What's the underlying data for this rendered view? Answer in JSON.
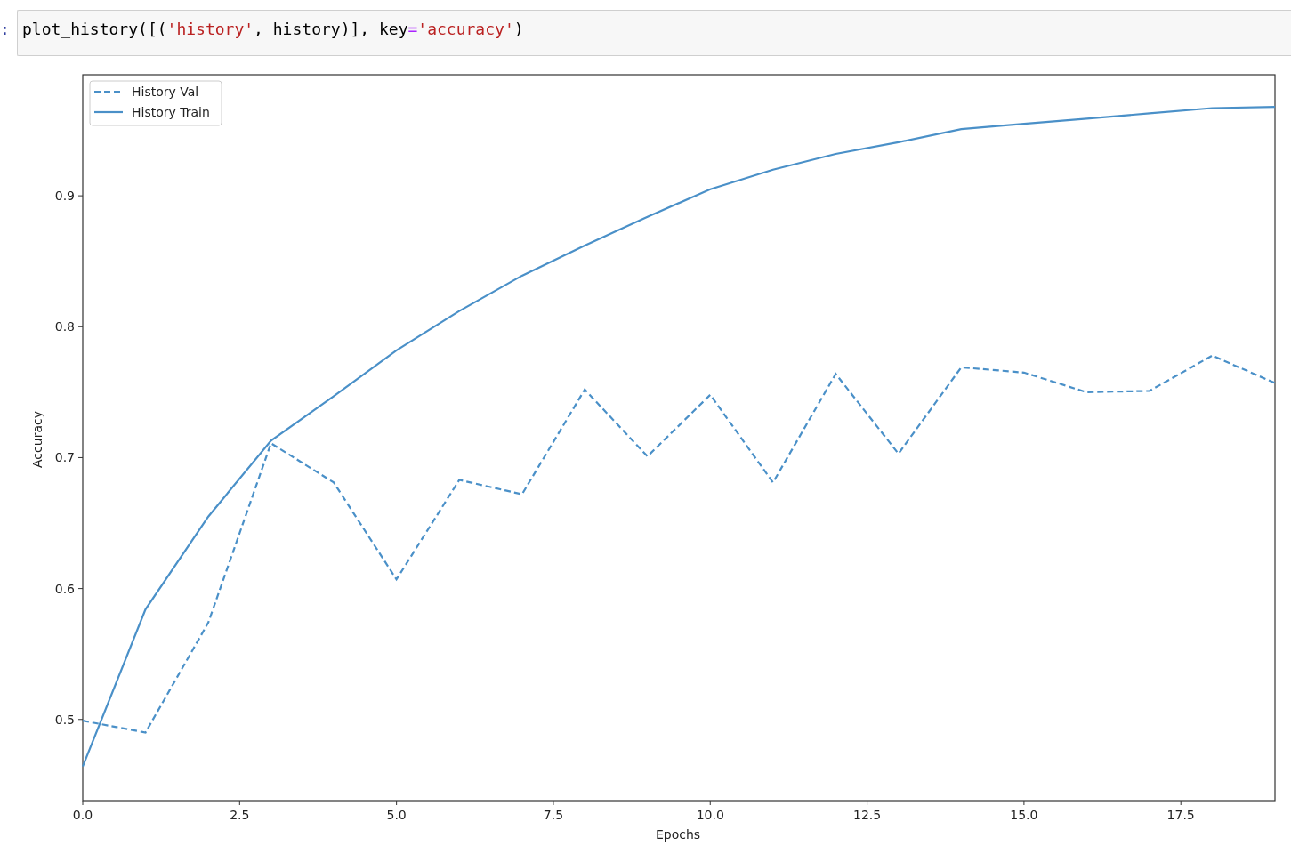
{
  "code_cell": {
    "prompt": ":",
    "tokens": [
      {
        "text": "plot_history([(",
        "kind": "plain"
      },
      {
        "text": "'history'",
        "kind": "string"
      },
      {
        "text": ", history)], key",
        "kind": "plain"
      },
      {
        "text": "=",
        "kind": "operator"
      },
      {
        "text": "'accuracy'",
        "kind": "string"
      },
      {
        "text": ")",
        "kind": "plain"
      }
    ]
  },
  "output": {
    "chart_data": {
      "type": "line",
      "xlabel": "Epochs",
      "ylabel": "Accuracy",
      "x": [
        0,
        1,
        2,
        3,
        4,
        5,
        6,
        7,
        8,
        9,
        10,
        11,
        12,
        13,
        14,
        15,
        16,
        17,
        18,
        19
      ],
      "series": [
        {
          "name": "History Val",
          "color": "#4a90c8",
          "line_style": "dashed",
          "values": [
            0.499,
            0.49,
            0.574,
            0.711,
            0.681,
            0.607,
            0.683,
            0.672,
            0.752,
            0.701,
            0.748,
            0.681,
            0.764,
            0.703,
            0.769,
            0.765,
            0.75,
            0.751,
            0.778,
            0.757
          ]
        },
        {
          "name": "History Train",
          "color": "#4a90c8",
          "line_style": "solid",
          "values": [
            0.464,
            0.584,
            0.655,
            0.713,
            0.747,
            0.782,
            0.812,
            0.839,
            0.862,
            0.884,
            0.905,
            0.92,
            0.932,
            0.941,
            0.951,
            0.955,
            0.959,
            0.963,
            0.967,
            0.968
          ]
        }
      ],
      "legend": true,
      "xlim": [
        0,
        19
      ],
      "ylim": [
        0.438,
        0.9925
      ],
      "xticks": [
        {
          "value": 0,
          "label": "0.0"
        },
        {
          "value": 2.5,
          "label": "2.5"
        },
        {
          "value": 5,
          "label": "5.0"
        },
        {
          "value": 7.5,
          "label": "7.5"
        },
        {
          "value": 10,
          "label": "10.0"
        },
        {
          "value": 12.5,
          "label": "12.5"
        },
        {
          "value": 15,
          "label": "15.0"
        },
        {
          "value": 17.5,
          "label": "17.5"
        }
      ],
      "yticks": [
        0.5,
        0.6,
        0.7,
        0.8,
        0.9
      ]
    }
  }
}
